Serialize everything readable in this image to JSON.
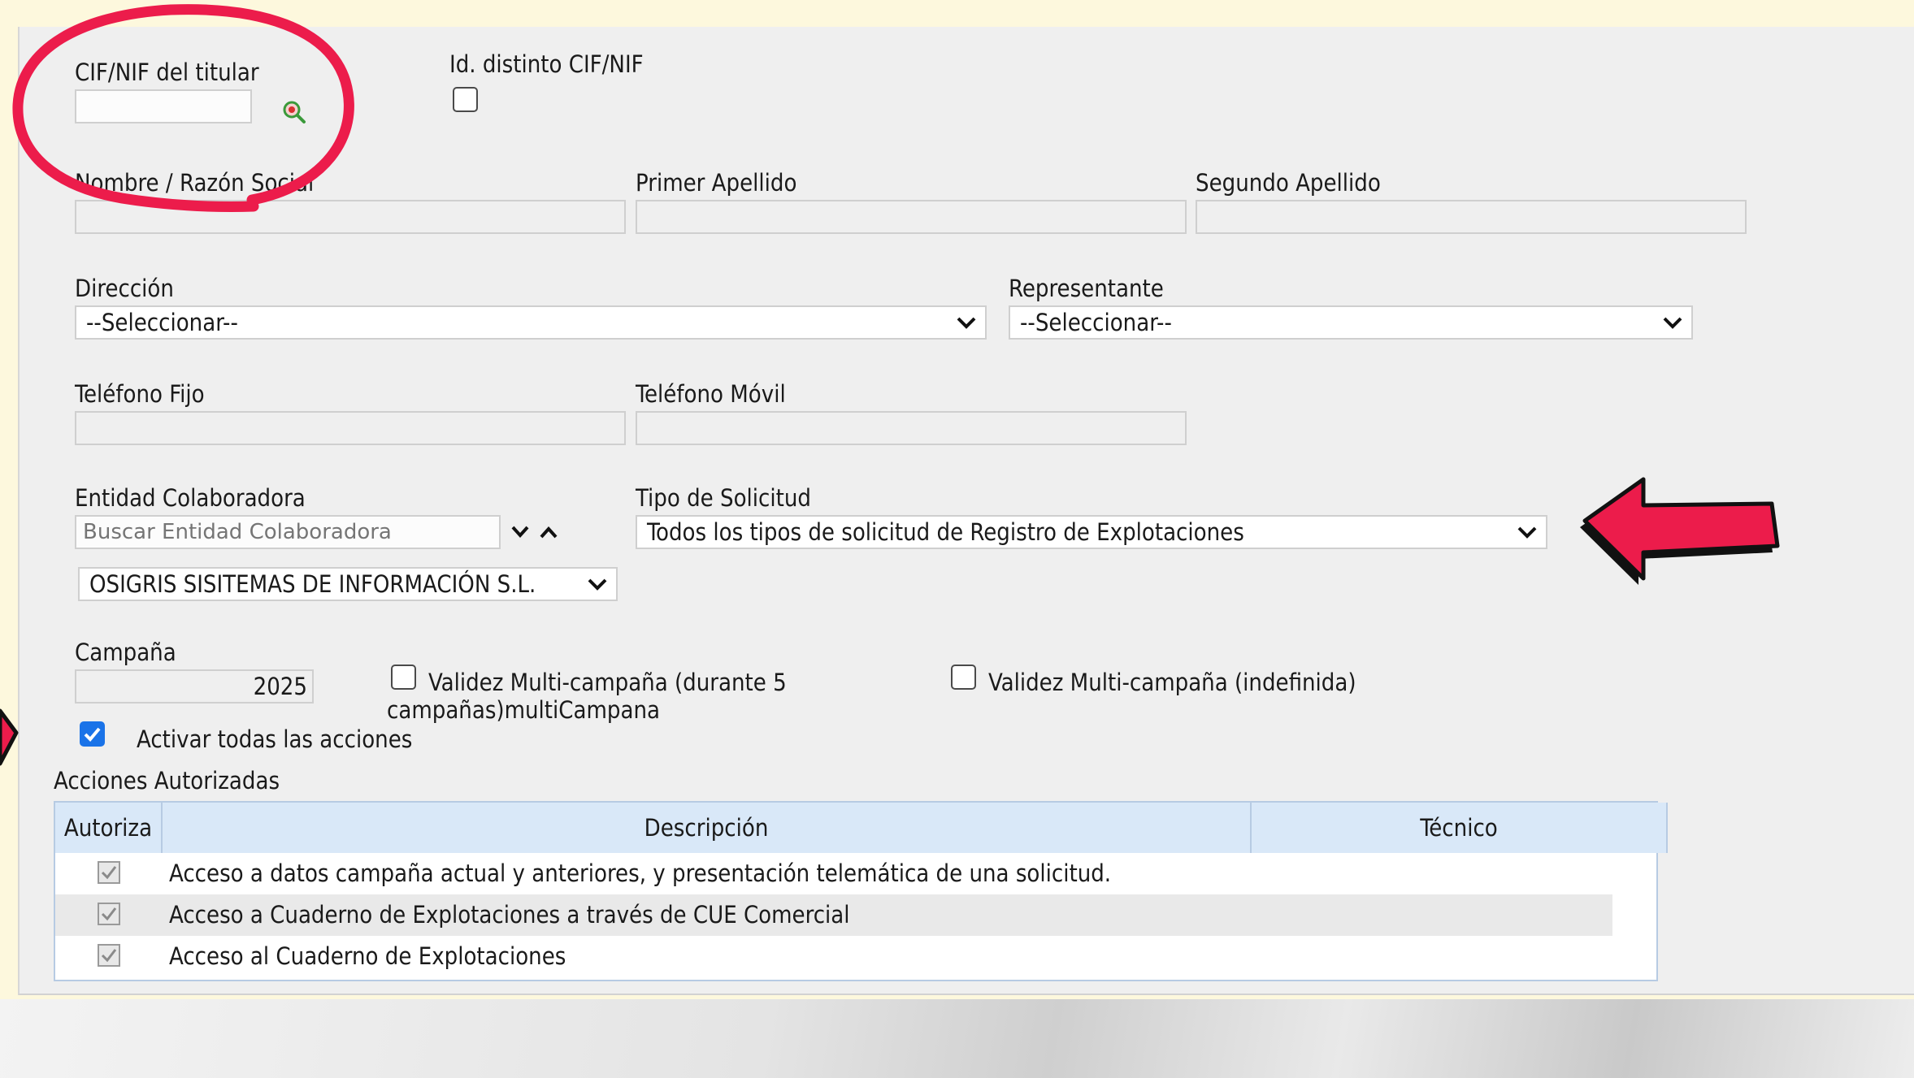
{
  "form": {
    "cif_label": "CIF/NIF del titular",
    "id_distinto_label": "Id. distinto CIF/NIF",
    "nombre_label": "Nombre / Razón Social",
    "primer_apellido_label": "Primer Apellido",
    "segundo_apellido_label": "Segundo Apellido",
    "direccion_label": "Dirección",
    "direccion_value": "--Seleccionar--",
    "representante_label": "Representante",
    "representante_value": "--Seleccionar--",
    "telefono_fijo_label": "Teléfono Fijo",
    "telefono_movil_label": "Teléfono Móvil",
    "entidad_label": "Entidad Colaboradora",
    "entidad_placeholder": "Buscar Entidad Colaboradora",
    "entidad_value": "OSIGRIS SISITEMAS DE INFORMACIÓN S.L.",
    "tipo_label": "Tipo de Solicitud",
    "tipo_value": "Todos los tipos de solicitud de Registro de Explotaciones",
    "campana_label": "Campaña",
    "campana_value": "2025",
    "multi5_label": "Validez Multi-campaña (durante 5",
    "multi5_label_cont": "campañas)multiCampana",
    "multi_indef_label": "Validez Multi-campaña (indefinida)",
    "activar_label": "Activar todas las acciones",
    "activar_checked": true,
    "acciones_title": "Acciones Autorizadas"
  },
  "table": {
    "headers": [
      "Autoriza",
      "Descripción",
      "Técnico"
    ],
    "rows": [
      {
        "desc": "Acceso a datos campaña actual y anteriores, y presentación telemática de una solicitud.",
        "checked": true
      },
      {
        "desc": "Acceso a Cuaderno de Explotaciones a través de CUE Comercial",
        "checked": true
      },
      {
        "desc": "Acceso al Cuaderno de Explotaciones",
        "checked": true
      }
    ]
  },
  "icons": {
    "search": "search-icon",
    "chevron": "chevron-down-icon",
    "annotation_circle": "highlight-circle",
    "annotation_arrow": "red-arrow-icon"
  },
  "colors": {
    "background": "#fdf8dd",
    "panel": "#efefef",
    "annotation": "#ec1c4b",
    "checkbox_accent": "#1a73e8",
    "table_header": "#d9e8f8"
  }
}
